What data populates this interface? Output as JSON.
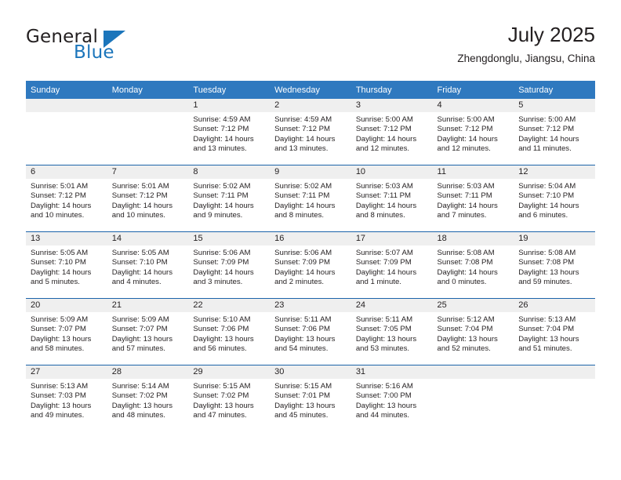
{
  "logo": {
    "word_one": "General",
    "word_two": "Blue",
    "icon": "triangle-icon",
    "accent_color": "#1b75bb"
  },
  "header": {
    "title": "July 2025",
    "subtitle": "Zhengdonglu, Jiangsu, China"
  },
  "calendar": {
    "header_bg": "#2f79bf",
    "row_divider_color": "#1c64aa",
    "date_band_bg": "#efefef",
    "weekday_headers": [
      "Sunday",
      "Monday",
      "Tuesday",
      "Wednesday",
      "Thursday",
      "Friday",
      "Saturday"
    ],
    "weeks": [
      [
        {
          "day": "",
          "blank": true,
          "sunrise": "",
          "sunset": "",
          "daylight_line1": "",
          "daylight_line2": ""
        },
        {
          "day": "",
          "blank": true,
          "sunrise": "",
          "sunset": "",
          "daylight_line1": "",
          "daylight_line2": ""
        },
        {
          "day": "1",
          "sunrise": "Sunrise: 4:59 AM",
          "sunset": "Sunset: 7:12 PM",
          "daylight_line1": "Daylight: 14 hours",
          "daylight_line2": "and 13 minutes."
        },
        {
          "day": "2",
          "sunrise": "Sunrise: 4:59 AM",
          "sunset": "Sunset: 7:12 PM",
          "daylight_line1": "Daylight: 14 hours",
          "daylight_line2": "and 13 minutes."
        },
        {
          "day": "3",
          "sunrise": "Sunrise: 5:00 AM",
          "sunset": "Sunset: 7:12 PM",
          "daylight_line1": "Daylight: 14 hours",
          "daylight_line2": "and 12 minutes."
        },
        {
          "day": "4",
          "sunrise": "Sunrise: 5:00 AM",
          "sunset": "Sunset: 7:12 PM",
          "daylight_line1": "Daylight: 14 hours",
          "daylight_line2": "and 12 minutes."
        },
        {
          "day": "5",
          "sunrise": "Sunrise: 5:00 AM",
          "sunset": "Sunset: 7:12 PM",
          "daylight_line1": "Daylight: 14 hours",
          "daylight_line2": "and 11 minutes."
        }
      ],
      [
        {
          "day": "6",
          "sunrise": "Sunrise: 5:01 AM",
          "sunset": "Sunset: 7:12 PM",
          "daylight_line1": "Daylight: 14 hours",
          "daylight_line2": "and 10 minutes."
        },
        {
          "day": "7",
          "sunrise": "Sunrise: 5:01 AM",
          "sunset": "Sunset: 7:12 PM",
          "daylight_line1": "Daylight: 14 hours",
          "daylight_line2": "and 10 minutes."
        },
        {
          "day": "8",
          "sunrise": "Sunrise: 5:02 AM",
          "sunset": "Sunset: 7:11 PM",
          "daylight_line1": "Daylight: 14 hours",
          "daylight_line2": "and 9 minutes."
        },
        {
          "day": "9",
          "sunrise": "Sunrise: 5:02 AM",
          "sunset": "Sunset: 7:11 PM",
          "daylight_line1": "Daylight: 14 hours",
          "daylight_line2": "and 8 minutes."
        },
        {
          "day": "10",
          "sunrise": "Sunrise: 5:03 AM",
          "sunset": "Sunset: 7:11 PM",
          "daylight_line1": "Daylight: 14 hours",
          "daylight_line2": "and 8 minutes."
        },
        {
          "day": "11",
          "sunrise": "Sunrise: 5:03 AM",
          "sunset": "Sunset: 7:11 PM",
          "daylight_line1": "Daylight: 14 hours",
          "daylight_line2": "and 7 minutes."
        },
        {
          "day": "12",
          "sunrise": "Sunrise: 5:04 AM",
          "sunset": "Sunset: 7:10 PM",
          "daylight_line1": "Daylight: 14 hours",
          "daylight_line2": "and 6 minutes."
        }
      ],
      [
        {
          "day": "13",
          "sunrise": "Sunrise: 5:05 AM",
          "sunset": "Sunset: 7:10 PM",
          "daylight_line1": "Daylight: 14 hours",
          "daylight_line2": "and 5 minutes."
        },
        {
          "day": "14",
          "sunrise": "Sunrise: 5:05 AM",
          "sunset": "Sunset: 7:10 PM",
          "daylight_line1": "Daylight: 14 hours",
          "daylight_line2": "and 4 minutes."
        },
        {
          "day": "15",
          "sunrise": "Sunrise: 5:06 AM",
          "sunset": "Sunset: 7:09 PM",
          "daylight_line1": "Daylight: 14 hours",
          "daylight_line2": "and 3 minutes."
        },
        {
          "day": "16",
          "sunrise": "Sunrise: 5:06 AM",
          "sunset": "Sunset: 7:09 PM",
          "daylight_line1": "Daylight: 14 hours",
          "daylight_line2": "and 2 minutes."
        },
        {
          "day": "17",
          "sunrise": "Sunrise: 5:07 AM",
          "sunset": "Sunset: 7:09 PM",
          "daylight_line1": "Daylight: 14 hours",
          "daylight_line2": "and 1 minute."
        },
        {
          "day": "18",
          "sunrise": "Sunrise: 5:08 AM",
          "sunset": "Sunset: 7:08 PM",
          "daylight_line1": "Daylight: 14 hours",
          "daylight_line2": "and 0 minutes."
        },
        {
          "day": "19",
          "sunrise": "Sunrise: 5:08 AM",
          "sunset": "Sunset: 7:08 PM",
          "daylight_line1": "Daylight: 13 hours",
          "daylight_line2": "and 59 minutes."
        }
      ],
      [
        {
          "day": "20",
          "sunrise": "Sunrise: 5:09 AM",
          "sunset": "Sunset: 7:07 PM",
          "daylight_line1": "Daylight: 13 hours",
          "daylight_line2": "and 58 minutes."
        },
        {
          "day": "21",
          "sunrise": "Sunrise: 5:09 AM",
          "sunset": "Sunset: 7:07 PM",
          "daylight_line1": "Daylight: 13 hours",
          "daylight_line2": "and 57 minutes."
        },
        {
          "day": "22",
          "sunrise": "Sunrise: 5:10 AM",
          "sunset": "Sunset: 7:06 PM",
          "daylight_line1": "Daylight: 13 hours",
          "daylight_line2": "and 56 minutes."
        },
        {
          "day": "23",
          "sunrise": "Sunrise: 5:11 AM",
          "sunset": "Sunset: 7:06 PM",
          "daylight_line1": "Daylight: 13 hours",
          "daylight_line2": "and 54 minutes."
        },
        {
          "day": "24",
          "sunrise": "Sunrise: 5:11 AM",
          "sunset": "Sunset: 7:05 PM",
          "daylight_line1": "Daylight: 13 hours",
          "daylight_line2": "and 53 minutes."
        },
        {
          "day": "25",
          "sunrise": "Sunrise: 5:12 AM",
          "sunset": "Sunset: 7:04 PM",
          "daylight_line1": "Daylight: 13 hours",
          "daylight_line2": "and 52 minutes."
        },
        {
          "day": "26",
          "sunrise": "Sunrise: 5:13 AM",
          "sunset": "Sunset: 7:04 PM",
          "daylight_line1": "Daylight: 13 hours",
          "daylight_line2": "and 51 minutes."
        }
      ],
      [
        {
          "day": "27",
          "sunrise": "Sunrise: 5:13 AM",
          "sunset": "Sunset: 7:03 PM",
          "daylight_line1": "Daylight: 13 hours",
          "daylight_line2": "and 49 minutes."
        },
        {
          "day": "28",
          "sunrise": "Sunrise: 5:14 AM",
          "sunset": "Sunset: 7:02 PM",
          "daylight_line1": "Daylight: 13 hours",
          "daylight_line2": "and 48 minutes."
        },
        {
          "day": "29",
          "sunrise": "Sunrise: 5:15 AM",
          "sunset": "Sunset: 7:02 PM",
          "daylight_line1": "Daylight: 13 hours",
          "daylight_line2": "and 47 minutes."
        },
        {
          "day": "30",
          "sunrise": "Sunrise: 5:15 AM",
          "sunset": "Sunset: 7:01 PM",
          "daylight_line1": "Daylight: 13 hours",
          "daylight_line2": "and 45 minutes."
        },
        {
          "day": "31",
          "sunrise": "Sunrise: 5:16 AM",
          "sunset": "Sunset: 7:00 PM",
          "daylight_line1": "Daylight: 13 hours",
          "daylight_line2": "and 44 minutes."
        },
        {
          "day": "",
          "blank": true,
          "sunrise": "",
          "sunset": "",
          "daylight_line1": "",
          "daylight_line2": ""
        },
        {
          "day": "",
          "blank": true,
          "sunrise": "",
          "sunset": "",
          "daylight_line1": "",
          "daylight_line2": ""
        }
      ]
    ]
  }
}
